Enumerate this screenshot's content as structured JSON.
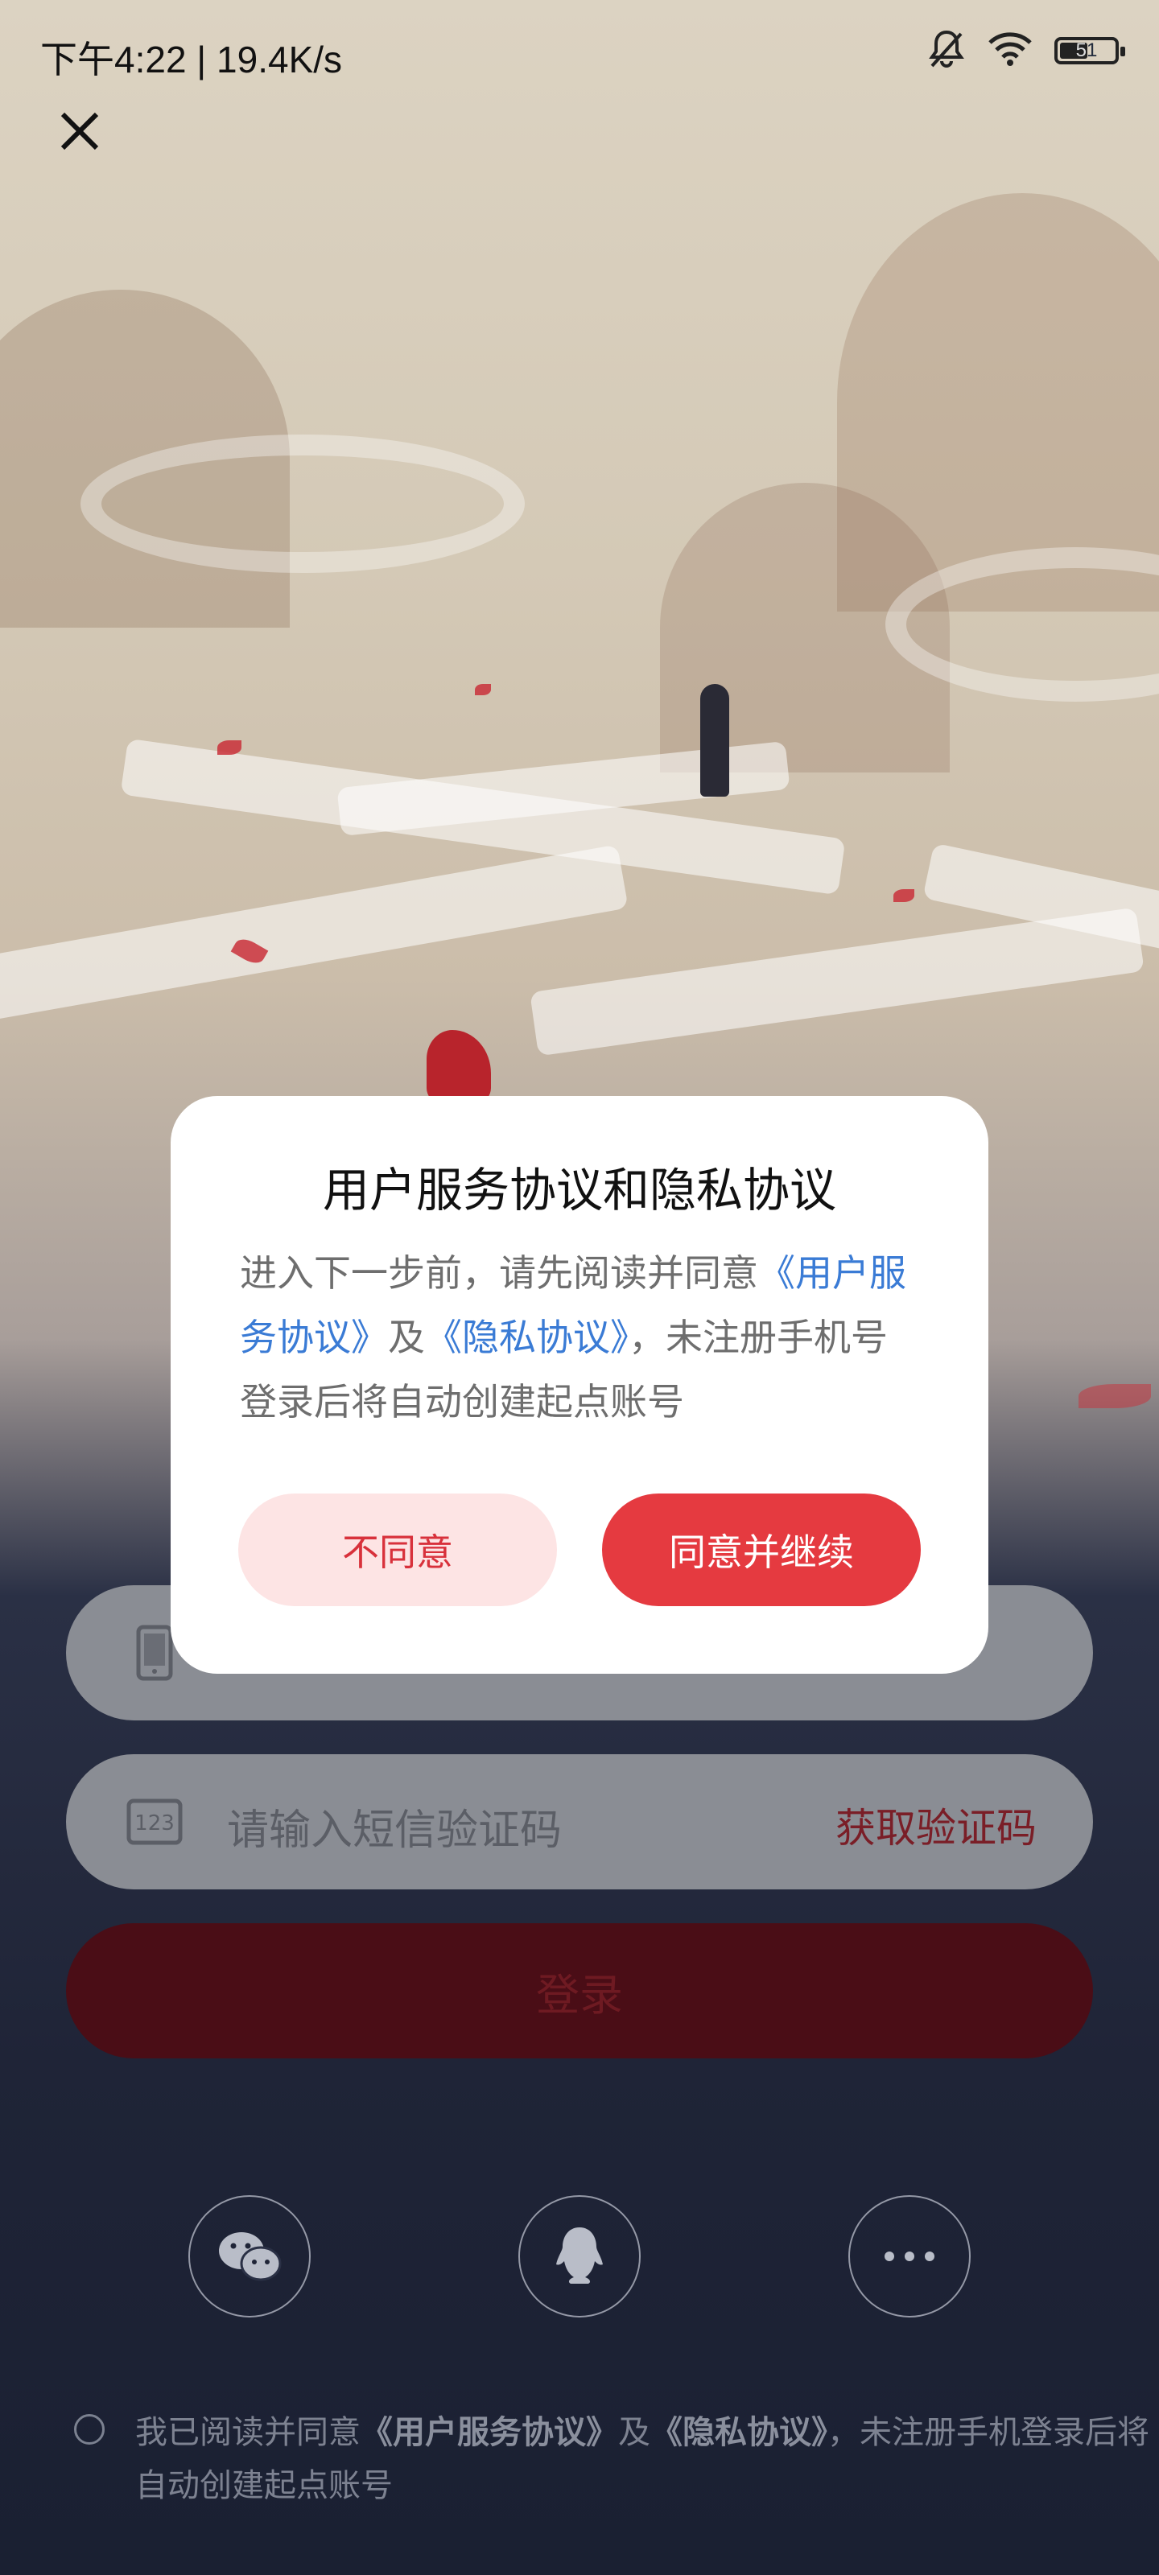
{
  "status_bar": {
    "time_speed": "下午4:22 | 19.4K/s",
    "battery": "51",
    "battery_level": 0.51,
    "icons": [
      "mute-bell-icon",
      "wifi-icon",
      "battery-icon"
    ]
  },
  "close_icon": "close-icon",
  "form": {
    "phone_icon": "phone-icon",
    "code_icon": "sms-code-icon",
    "code_placeholder": "请输入短信验证码",
    "get_code_label": "获取验证码",
    "login_label": "登录"
  },
  "social": {
    "wechat_icon": "wechat-icon",
    "qq_icon": "qq-icon",
    "more_icon": "more-icon"
  },
  "agreement": {
    "prefix": "我已阅读并同意",
    "user_agreement": "《用户服务协议》",
    "and": "及",
    "privacy": "《隐私协议》",
    "suffix": "，未注册手机登录后将自动创建起点账号"
  },
  "dialog": {
    "title": "用户服务协议和隐私协议",
    "body_prefix": "进入下一步前，请先阅读并同意",
    "link_user": "《用户服务协议》",
    "and": "及",
    "link_privacy": "《隐私协议》",
    "body_suffix": "，未注册手机号登录后将自动创建起点账号",
    "disagree_label": "不同意",
    "agree_label": "同意并继续"
  },
  "colors": {
    "accent": "#e53a40",
    "disagree_bg": "#fde4e4",
    "link": "#3a7bd5"
  }
}
